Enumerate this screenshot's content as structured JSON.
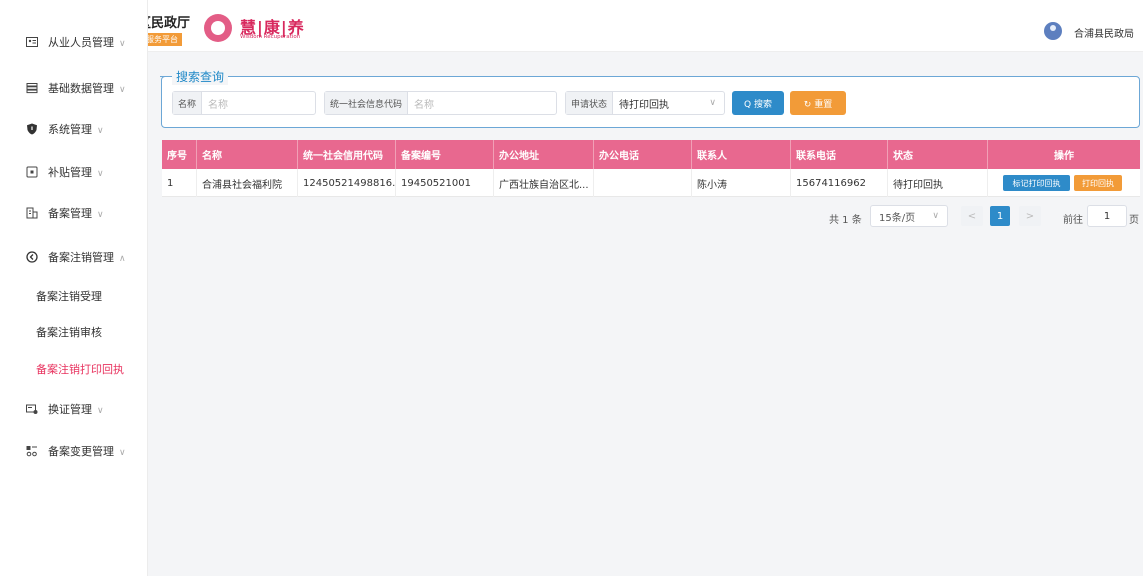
{
  "header": {
    "brand_title": "区民政厅",
    "brand_tag": "服务平台",
    "logo_text": "慧|康|养",
    "logo_sub": "Wisdom Recuperation",
    "user_name": "合浦县民政局"
  },
  "sidebar": {
    "items": [
      {
        "label": "从业人员管理",
        "icon": "id-card-icon",
        "chevron": "∨"
      },
      {
        "label": "基础数据管理",
        "icon": "list-icon",
        "chevron": "∨"
      },
      {
        "label": "系统管理",
        "icon": "shield-icon",
        "chevron": "∨"
      },
      {
        "label": "补贴管理",
        "icon": "box-icon",
        "chevron": "∨"
      },
      {
        "label": "备案管理",
        "icon": "building-icon",
        "chevron": "∨"
      },
      {
        "label": "备案注销管理",
        "icon": "back-circle-icon",
        "chevron": "∧"
      }
    ],
    "sub_items": [
      {
        "label": "备案注销受理",
        "active": false
      },
      {
        "label": "备案注销审核",
        "active": false
      },
      {
        "label": "备案注销打印回执",
        "active": true
      }
    ],
    "items_after": [
      {
        "label": "换证管理",
        "icon": "card-exchange-icon",
        "chevron": "∨"
      },
      {
        "label": "备案变更管理",
        "icon": "change-icon",
        "chevron": "∨"
      }
    ]
  },
  "search": {
    "legend": "搜索查询",
    "name_label": "名称",
    "name_placeholder": "名称",
    "code_label": "统一社会信息代码",
    "code_placeholder": "名称",
    "status_label": "申请状态",
    "status_value": "待打印回执",
    "search_button": "Q 搜索",
    "reset_button": "↻ 重置"
  },
  "table": {
    "columns": [
      "序号",
      "名称",
      "统一社会信用代码",
      "备案编号",
      "办公地址",
      "办公电话",
      "联系人",
      "联系电话",
      "状态",
      "操作"
    ],
    "rows": [
      [
        "1",
        "合浦县社会福利院",
        "12450521498816...",
        "19450521001",
        "广西壮族自治区北...",
        "",
        "陈小涛",
        "15674116962",
        "待打印回执"
      ]
    ],
    "op_mark": "标记打印回执",
    "op_print": "打印回执"
  },
  "pagination": {
    "total": "共 1 条",
    "page_size": "15条/页",
    "prev": "<",
    "current_page": "1",
    "next": ">",
    "goto_label": "前往",
    "goto_value": "1",
    "goto_unit": "页"
  },
  "colors": {
    "accent_pink": "#e8688f",
    "active_menu": "#e8335f",
    "primary_blue": "#2e8bc9",
    "orange": "#f29b38"
  }
}
